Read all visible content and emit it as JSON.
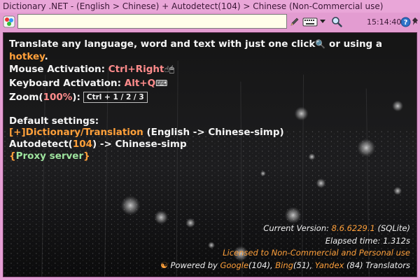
{
  "window": {
    "title": "Dictionary .NET - (English > Chinese) + Autodetect(104) > Chinese (Non-Commercial use)"
  },
  "toolbar": {
    "search_value": "",
    "time": "15:14:40",
    "icons": [
      "app-icon",
      "pencil-icon",
      "keyboard-icon",
      "dropdown-arrow-icon",
      "search-icon",
      "help-icon",
      "pin-icon"
    ]
  },
  "intro": {
    "line1": "Translate any language, word and text with just one click",
    "line1b": " or using a",
    "hotkey": "hotkey",
    "period": "."
  },
  "mouse": {
    "label": "Mouse Activation: ",
    "value": "Ctrl+Right"
  },
  "keyboard": {
    "label": "Keyboard Activation: ",
    "value": "Alt+Q"
  },
  "zoom": {
    "label": "Zoom(",
    "value": "100%",
    "close": "):",
    "keys": "Ctrl + 1 / 2 / 3"
  },
  "defaults": {
    "heading": "Default settings:",
    "dict_link": "[+]Dictionary/Translation",
    "dict_pair": " (English -> Chinese-simp)",
    "auto_label": "Autodetect(",
    "auto_count": "104",
    "auto_rest": ") -> Chinese-simp",
    "proxy_open": "{",
    "proxy_link": "Proxy server",
    "proxy_close": "}"
  },
  "footer": {
    "version_label": "Current Version: ",
    "version": "8.6.6229.1",
    "version_db": " (SQLite)",
    "elapsed": "Elapsed time: 1.312s",
    "license": "Licensed to Non-Commercial and Personal use",
    "powered": "Powered by ",
    "google": "Google",
    "google_count": "(104), ",
    "bing": "Bing",
    "bing_count": "(51), ",
    "yandex": "Yandex",
    "yandex_count": " (84) Translators"
  },
  "colors": {
    "titlebar": "#e9a6d8",
    "accent_orange": "#ffa03a",
    "accent_pink": "#ff8c8c",
    "accent_green": "#9ee49e"
  }
}
